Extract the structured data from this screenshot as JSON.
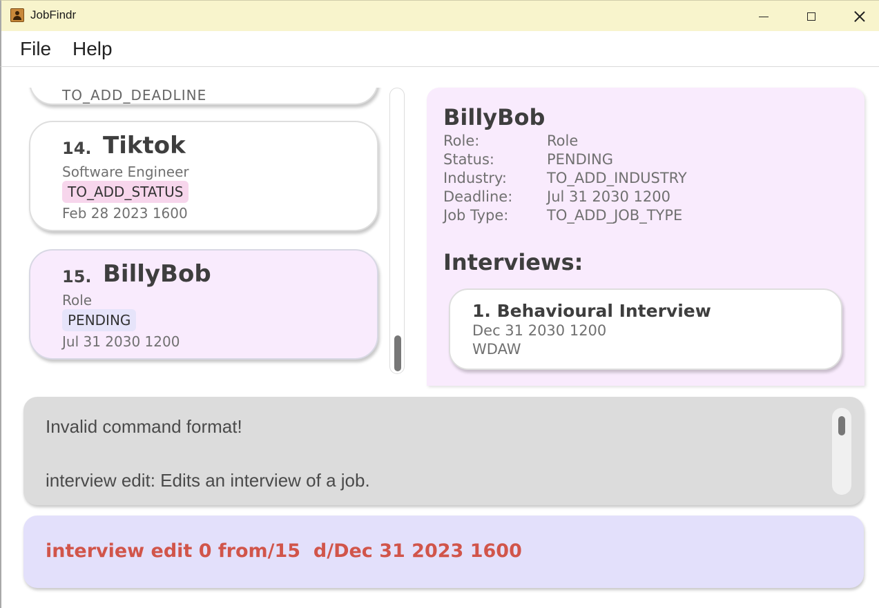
{
  "window": {
    "title": "JobFindr"
  },
  "menu": {
    "file": "File",
    "help": "Help"
  },
  "job_list": {
    "partial_card_text": "TO_ADD_DEADLINE",
    "cards": [
      {
        "index": "14.",
        "company": "Tiktok",
        "role": "Software Engineer",
        "status": "TO_ADD_STATUS",
        "status_color": "#f7d6ec",
        "deadline": "Feb 28 2023 1600",
        "selected": false
      },
      {
        "index": "15.",
        "company": "BillyBob",
        "role": "Role",
        "status": "PENDING",
        "status_color": "#e6e4fa",
        "deadline": "Jul 31 2030 1200",
        "selected": true
      }
    ]
  },
  "detail": {
    "name": "BillyBob",
    "fields": [
      {
        "label": "Role:",
        "value": "Role"
      },
      {
        "label": "Status:",
        "value": "PENDING"
      },
      {
        "label": "Industry:",
        "value": "TO_ADD_INDUSTRY"
      },
      {
        "label": "Deadline:",
        "value": "Jul 31 2030 1200"
      },
      {
        "label": "Job Type:",
        "value": "TO_ADD_JOB_TYPE"
      }
    ],
    "interviews_heading": "Interviews:",
    "interviews": [
      {
        "title": "1. Behavioural Interview",
        "date": "Dec 31 2030 1200",
        "location": "WDAW"
      }
    ]
  },
  "result": {
    "line1": "Invalid command format!",
    "line2": "interview edit: Edits an interview of a job."
  },
  "command": {
    "value": "interview edit 0 from/15  d/Dec 31 2023 1600"
  }
}
